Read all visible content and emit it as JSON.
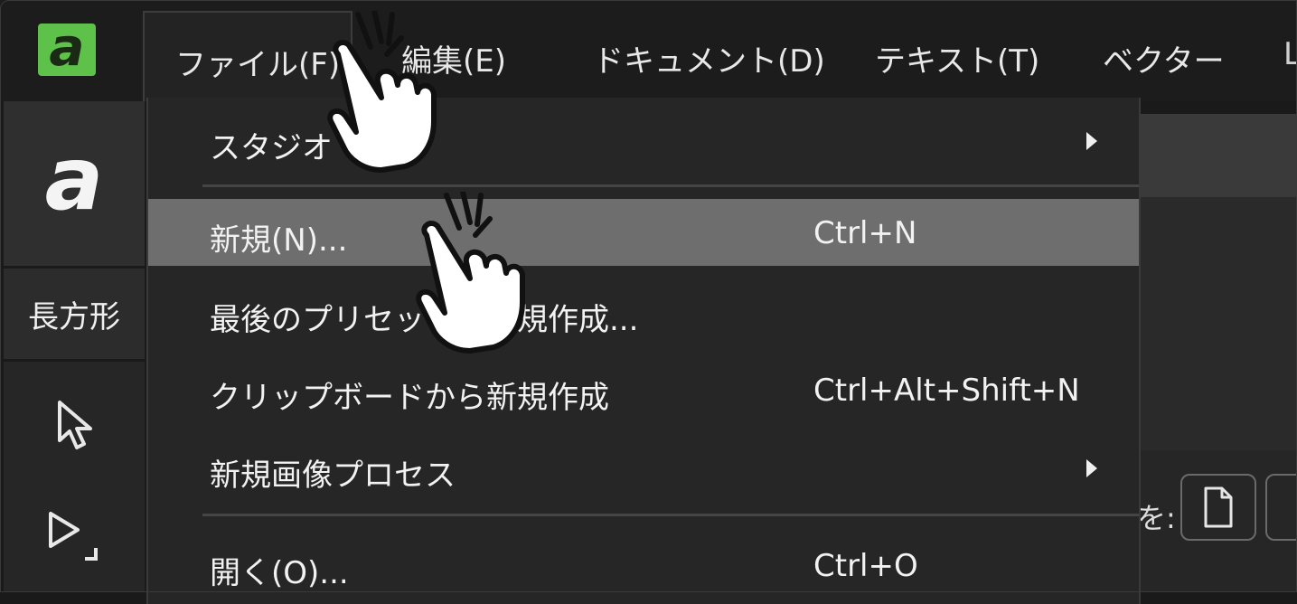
{
  "menubar": {
    "logo_letter": "a",
    "items": [
      {
        "label": "ファイル(F)"
      },
      {
        "label": "編集(E)"
      },
      {
        "label": "ドキュメント(D)"
      },
      {
        "label": "テキスト(T)"
      },
      {
        "label": "ベクター"
      }
    ]
  },
  "toolbar": {
    "logo_letter": "a",
    "shape_label": "長方形",
    "tools": [
      {
        "icon": "pointer-arrow-icon"
      },
      {
        "icon": "node-select-icon"
      }
    ]
  },
  "file_menu": {
    "items": [
      {
        "label": "スタジオ",
        "shortcut": "",
        "submenu": true
      },
      {
        "label": "新規(N)...",
        "shortcut": "Ctrl+N",
        "submenu": false,
        "highlighted": true
      },
      {
        "label": "最後のプリセットで新規作成...",
        "shortcut": "",
        "submenu": false
      },
      {
        "label": "クリップボードから新規作成",
        "shortcut": "Ctrl+Alt+Shift+N",
        "submenu": false
      },
      {
        "label": "新規画像プロセス",
        "shortcut": "",
        "submenu": true
      },
      {
        "label": "開く(O)...",
        "shortcut": "Ctrl+O",
        "submenu": false
      }
    ]
  },
  "right_panel": {
    "label": "を:"
  },
  "colors": {
    "logo_green": "#5ec24a",
    "highlight": "#6e6e6e",
    "menu_bg": "#262626"
  }
}
